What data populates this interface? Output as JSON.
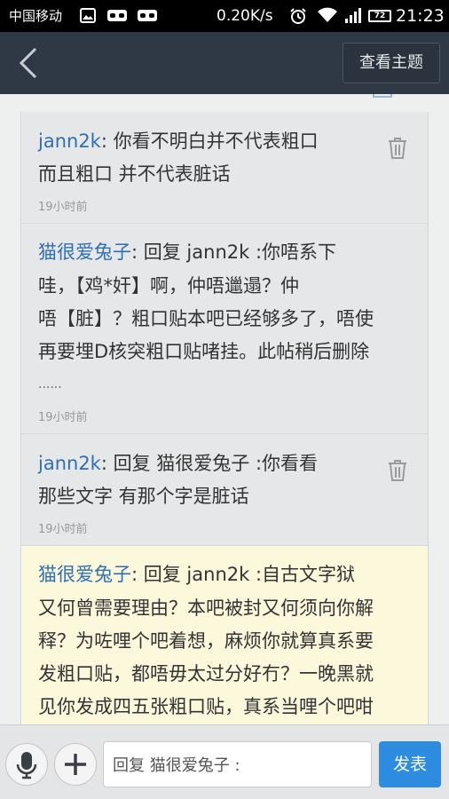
{
  "status_bar": {
    "carrier": "中国移动",
    "speed": "0.20K/s",
    "battery": "72",
    "time": "21:23"
  },
  "header": {
    "back_icon": "chevron-left-icon",
    "view_topic_label": "查看主题"
  },
  "comments": [
    {
      "author": "jann2k",
      "lines": [
        ": 你看不明白并不代表粗口",
        "而且粗口 并不代表脏话"
      ],
      "time": "19小时前",
      "deletable": true
    },
    {
      "author": "猫很爱兔子",
      "lines": [
        ": 回复 jann2k :你唔系下",
        "哇，【鸡*奸】啊，仲唔邋遢？仲",
        "唔【脏】？粗口贴本吧已经够多了，唔使",
        "再要埋D核突粗口贴啫挂。此帖稍后删除",
        "......"
      ],
      "time": "19小时前",
      "deletable": false
    },
    {
      "author": "jann2k",
      "lines": [
        ": 回复 猫很爱兔子 :你看看",
        "那些文字 有那个字是脏话"
      ],
      "time": "19小时前",
      "deletable": true
    },
    {
      "author": "猫很爱兔子",
      "lines": [
        ": 回复 jann2k :自古文字狱",
        "又何曾需要理由？本吧被封又何须向你解",
        "释？为咗哩个吧着想，麻烦你就算真系要",
        "发粗口贴，都唔毋太过分好冇？一晚黑就",
        "见你发成四五张粗口贴，真系当哩个吧咁"
      ],
      "time": "",
      "deletable": false,
      "highlighted": true
    }
  ],
  "bottom_bar": {
    "mic_icon": "microphone-icon",
    "plus_icon": "plus-icon",
    "input_value": "回复 猫很爱兔子 :",
    "send_label": "发表"
  },
  "colors": {
    "header_bg": "#2f3945",
    "author_blue": "#2f6fb4",
    "send_blue": "#2d8be0",
    "highlight_bg": "#fbf8dc"
  }
}
